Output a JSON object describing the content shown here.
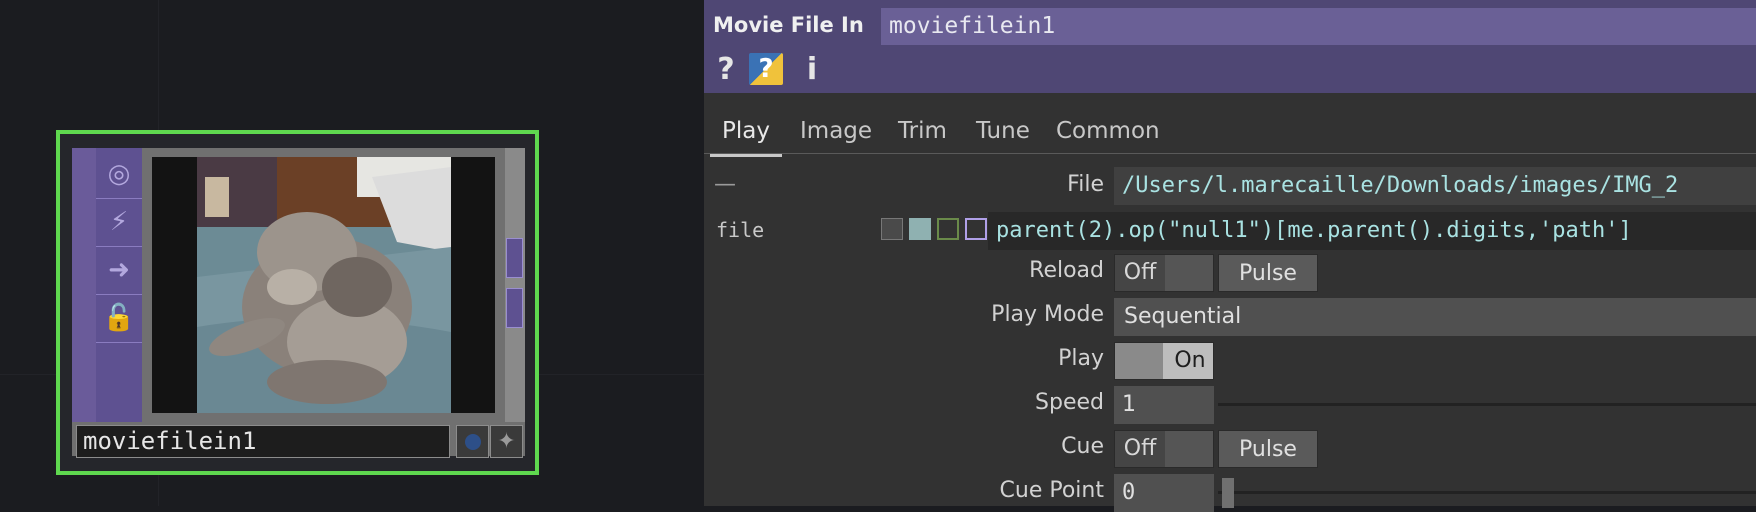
{
  "network": {
    "node": {
      "name": "moviefilein1",
      "flags": [
        {
          "icon": "bypass-flag-icon",
          "glyph": "◎"
        },
        {
          "icon": "cook-flag-icon",
          "glyph": "⚡"
        },
        {
          "icon": "export-flag-icon",
          "glyph": "➜"
        },
        {
          "icon": "lock-flag-icon",
          "glyph": "🔓"
        }
      ],
      "preview_subject": "photo of a fluffy grey cat lying on a blue blanket"
    }
  },
  "panel": {
    "op_type": "Movie File In",
    "op_name": "moviefilein1",
    "header_icons": {
      "help": "?",
      "python_help": "?",
      "info": "i"
    },
    "tabs": [
      {
        "label": "Play",
        "active": true
      },
      {
        "label": "Image",
        "active": false
      },
      {
        "label": "Trim",
        "active": false
      },
      {
        "label": "Tune",
        "active": false
      },
      {
        "label": "Common",
        "active": false
      }
    ],
    "file": {
      "label": "File",
      "value": "/Users/l.marecaille/Downloads/images/IMG_2",
      "dash": "—",
      "code": "file",
      "expression": "parent(2).op(\"null1\")[me.parent().digits,'path']"
    },
    "reload": {
      "label": "Reload",
      "state": "Off",
      "button": "Pulse"
    },
    "play_mode": {
      "label": "Play Mode",
      "value": "Sequential"
    },
    "play": {
      "label": "Play",
      "state": "On"
    },
    "speed": {
      "label": "Speed",
      "value": "1"
    },
    "cue": {
      "label": "Cue",
      "state": "Off",
      "button": "Pulse"
    },
    "cue_point": {
      "label": "Cue Point",
      "value": "0"
    }
  },
  "colors": {
    "selection_outline": "#5fd84f",
    "header_bg": "#4f4774",
    "name_field_bg": "#6a6096",
    "expression_text": "#a9e2e2"
  }
}
